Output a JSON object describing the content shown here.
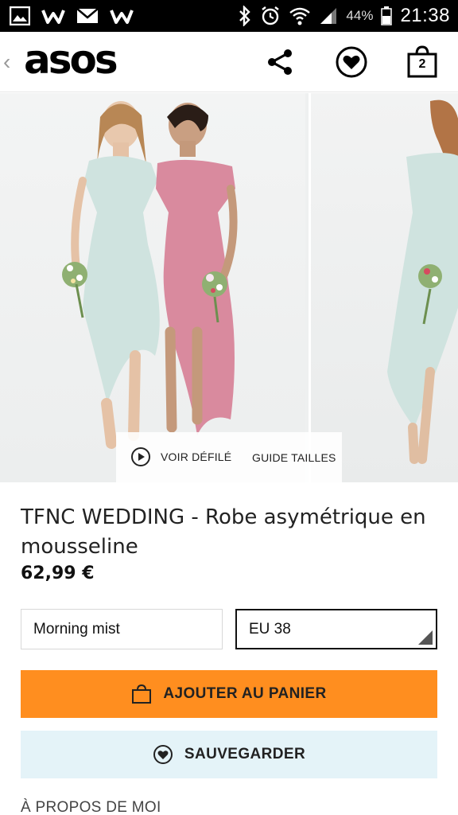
{
  "status_bar": {
    "battery_percent": "44%",
    "time": "21:38"
  },
  "header": {
    "logo": "asos",
    "bag_count": "2",
    "icons": [
      "chevron-left-icon",
      "share-icon",
      "heart-icon",
      "bag-icon"
    ]
  },
  "gallery": {
    "watch_catwalk_label": "VOIR DÉFILÉ",
    "size_guide_label": "GUIDE TAILLES"
  },
  "product": {
    "title": "TFNC WEDDING - Robe asymétrique en mousseline",
    "price": "62,99 €",
    "colour_value": "Morning mist",
    "size_value": "EU 38"
  },
  "actions": {
    "add_to_bag_label": "AJOUTER AU PANIER",
    "save_label": "SAUVEGARDER"
  },
  "sections": {
    "about_label": "À PROPOS DE MOI"
  },
  "colors": {
    "accent_orange": "#ff8e1f",
    "save_bg": "#e4f3f8",
    "dress_mint": "#cfe3df",
    "dress_pink": "#d98a9e"
  }
}
